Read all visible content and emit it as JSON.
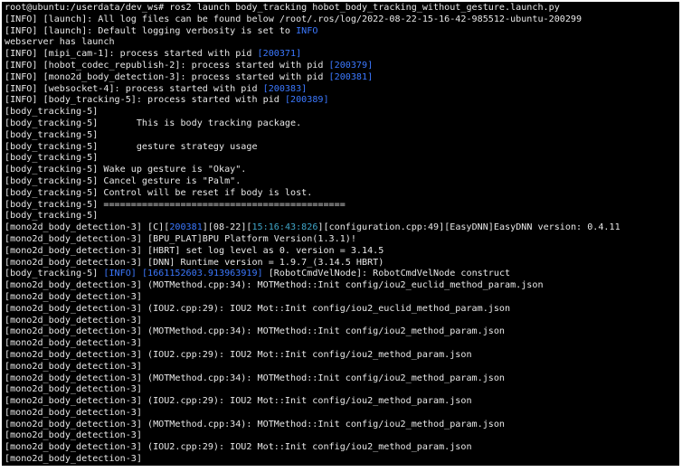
{
  "colors": {
    "background": "#000000",
    "text": "#e8e8e8",
    "info_blue": "#3b78ff",
    "cyan": "#3fa5c8"
  },
  "terminal": {
    "lines": [
      [
        {
          "t": "root@ubuntu:/userdata/dev_ws# ros2 launch body_tracking hobot_body_tracking_without_gesture.launch.py",
          "c": "default"
        }
      ],
      [
        {
          "t": "[INFO] [launch]: All log files can be found below /root/.ros/log/2022-08-22-15-16-42-985512-ubuntu-200299",
          "c": "default"
        }
      ],
      [
        {
          "t": "[INFO] [launch]: Default logging verbosity is set to ",
          "c": "default"
        },
        {
          "t": "INFO",
          "c": "blue"
        }
      ],
      [
        {
          "t": "webserver has launch",
          "c": "default"
        }
      ],
      [
        {
          "t": "[INFO] [mipi_cam-1]: process started with pid ",
          "c": "default"
        },
        {
          "t": "[200371]",
          "c": "blue"
        }
      ],
      [
        {
          "t": "[INFO] [hobot_codec_republish-2]: process started with pid ",
          "c": "default"
        },
        {
          "t": "[200379]",
          "c": "blue"
        }
      ],
      [
        {
          "t": "[INFO] [mono2d_body_detection-3]: process started with pid ",
          "c": "default"
        },
        {
          "t": "[200381]",
          "c": "blue"
        }
      ],
      [
        {
          "t": "[INFO] [websocket-4]: process started with pid ",
          "c": "default"
        },
        {
          "t": "[200383]",
          "c": "blue"
        }
      ],
      [
        {
          "t": "[INFO] [body_tracking-5]: process started with pid ",
          "c": "default"
        },
        {
          "t": "[200389]",
          "c": "blue"
        }
      ],
      [
        {
          "t": "[body_tracking-5]",
          "c": "default"
        }
      ],
      [
        {
          "t": "[body_tracking-5]       This is body tracking package.",
          "c": "default"
        }
      ],
      [
        {
          "t": "[body_tracking-5]",
          "c": "default"
        }
      ],
      [
        {
          "t": "[body_tracking-5]       gesture strategy usage",
          "c": "default"
        }
      ],
      [
        {
          "t": "[body_tracking-5]",
          "c": "default"
        }
      ],
      [
        {
          "t": "[body_tracking-5] Wake up gesture is \"Okay\".",
          "c": "default"
        }
      ],
      [
        {
          "t": "[body_tracking-5] Cancel gesture is \"Palm\".",
          "c": "default"
        }
      ],
      [
        {
          "t": "[body_tracking-5] Control will be reset if body is lost.",
          "c": "default"
        }
      ],
      [
        {
          "t": "[body_tracking-5] ============================================",
          "c": "default"
        }
      ],
      [
        {
          "t": "[body_tracking-5]",
          "c": "default"
        }
      ],
      [
        {
          "t": "[mono2d_body_detection-3] [C][",
          "c": "default"
        },
        {
          "t": "200381",
          "c": "blue"
        },
        {
          "t": "][08-22][",
          "c": "default"
        },
        {
          "t": "15:16:43:826",
          "c": "cyan"
        },
        {
          "t": "][configuration.cpp:49][EasyDNN]EasyDNN version: 0.4.11",
          "c": "default"
        }
      ],
      [
        {
          "t": "[mono2d_body_detection-3] [BPU_PLAT]BPU Platform Version(1.3.1)!",
          "c": "default"
        }
      ],
      [
        {
          "t": "[mono2d_body_detection-3] [HBRT] set log level as 0. version = 3.14.5",
          "c": "default"
        }
      ],
      [
        {
          "t": "[mono2d_body_detection-3] [DNN] Runtime version = 1.9.7_(3.14.5 HBRT)",
          "c": "default"
        }
      ],
      [
        {
          "t": "[body_tracking-5] ",
          "c": "default"
        },
        {
          "t": "[INFO]",
          "c": "blue"
        },
        {
          "t": " ",
          "c": "default"
        },
        {
          "t": "[1661152603.913963919]",
          "c": "blue"
        },
        {
          "t": " [RobotCmdVelNode]: RobotCmdVelNode construct",
          "c": "default"
        }
      ],
      [
        {
          "t": "[mono2d_body_detection-3] (MOTMethod.cpp:34): MOTMethod::Init config/iou2_euclid_method_param.json",
          "c": "default"
        }
      ],
      [
        {
          "t": "[mono2d_body_detection-3]",
          "c": "default"
        }
      ],
      [
        {
          "t": "[mono2d_body_detection-3] (IOU2.cpp:29): IOU2 Mot::Init config/iou2_euclid_method_param.json",
          "c": "default"
        }
      ],
      [
        {
          "t": "[mono2d_body_detection-3]",
          "c": "default"
        }
      ],
      [
        {
          "t": "[mono2d_body_detection-3] (MOTMethod.cpp:34): MOTMethod::Init config/iou2_method_param.json",
          "c": "default"
        }
      ],
      [
        {
          "t": "[mono2d_body_detection-3]",
          "c": "default"
        }
      ],
      [
        {
          "t": "[mono2d_body_detection-3] (IOU2.cpp:29): IOU2 Mot::Init config/iou2_method_param.json",
          "c": "default"
        }
      ],
      [
        {
          "t": "[mono2d_body_detection-3]",
          "c": "default"
        }
      ],
      [
        {
          "t": "[mono2d_body_detection-3] (MOTMethod.cpp:34): MOTMethod::Init config/iou2_method_param.json",
          "c": "default"
        }
      ],
      [
        {
          "t": "[mono2d_body_detection-3]",
          "c": "default"
        }
      ],
      [
        {
          "t": "[mono2d_body_detection-3] (IOU2.cpp:29): IOU2 Mot::Init config/iou2_method_param.json",
          "c": "default"
        }
      ],
      [
        {
          "t": "[mono2d_body_detection-3]",
          "c": "default"
        }
      ],
      [
        {
          "t": "[mono2d_body_detection-3] (MOTMethod.cpp:34): MOTMethod::Init config/iou2_method_param.json",
          "c": "default"
        }
      ],
      [
        {
          "t": "[mono2d_body_detection-3]",
          "c": "default"
        }
      ],
      [
        {
          "t": "[mono2d_body_detection-3] (IOU2.cpp:29): IOU2 Mot::Init config/iou2_method_param.json",
          "c": "default"
        }
      ],
      [
        {
          "t": "[mono2d_body_detection-3]",
          "c": "default"
        }
      ]
    ]
  }
}
